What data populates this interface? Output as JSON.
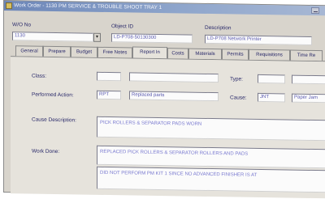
{
  "window": {
    "title": "Work Order - 1130 PM SERVICE & TROUBLE SHOOT TRAY 1"
  },
  "header": {
    "wo_no": {
      "label": "W/O No",
      "value": "1130"
    },
    "object_id": {
      "label": "Object ID",
      "value": "LD-P708-50130300"
    },
    "description": {
      "label": "Description",
      "value": "LD-P708 Network Printer"
    },
    "dropdown_glyph": "▼"
  },
  "tabs": [
    {
      "label": "General"
    },
    {
      "label": "Prepare"
    },
    {
      "label": "Budget"
    },
    {
      "label": "Free Notes"
    },
    {
      "label": "Report In"
    },
    {
      "label": "Costs"
    },
    {
      "label": "Materials"
    },
    {
      "label": "Permits"
    },
    {
      "label": "Requisitions"
    },
    {
      "label": "Time Re"
    }
  ],
  "active_tab_index": 4,
  "report_in": {
    "class_label": "Class:",
    "class_value": "",
    "class_desc": "",
    "type_label": "Type:",
    "type_value": "",
    "type_desc": "",
    "performed_action_label": "Performed Action:",
    "performed_action_code": "RPT",
    "performed_action_desc": "Replaced parts",
    "cause_label": "Cause:",
    "cause_code": "JNT",
    "cause_desc": "Paper Jam",
    "cause_description_label": "Cause Description:",
    "cause_description_value": "PICK ROLLERS & SEPARATOR PADS WORN",
    "work_done_label": "Work Done:",
    "work_done_line1": "REPLACED PICK ROLLERS & SEPARATOR ROLLERS AND PADS",
    "work_done_line2": "DID NOT PERFORM PM KIT 1 SINCE NO ADVANCED FINISHER IS AT"
  }
}
